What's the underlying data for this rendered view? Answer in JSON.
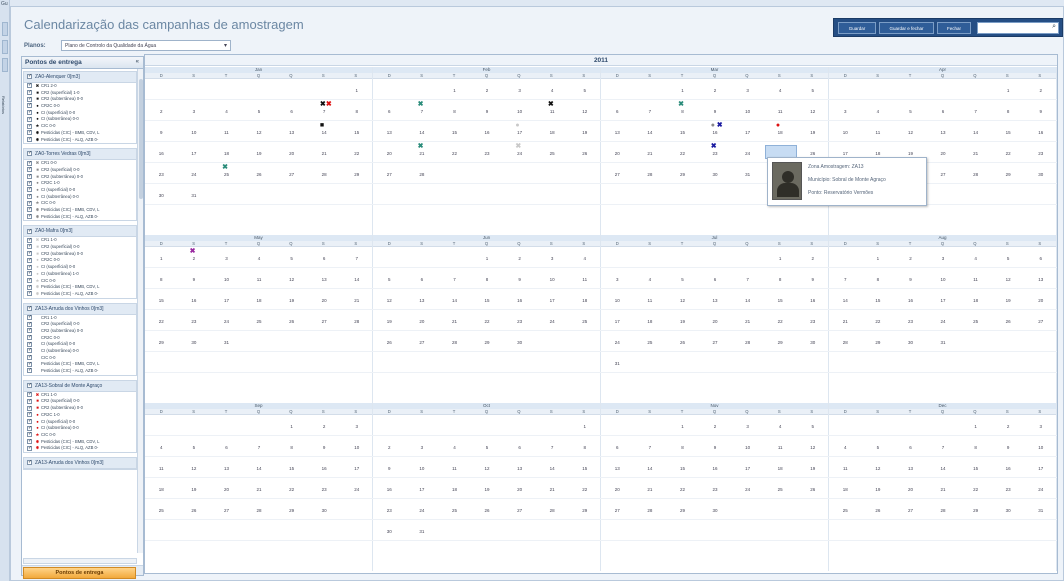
{
  "window": {
    "corner_label": "Gu"
  },
  "left_strip": {
    "vertical_label": "Relatórios"
  },
  "header": {
    "title": "Calendarização das campanhas de amostragem"
  },
  "planos": {
    "label": "Planos:",
    "selected": "Plano de Controlo da Qualidade da Água"
  },
  "toolbar": {
    "save_label": "Guardar",
    "save_close_label": "Guardar e fechar",
    "close_label": "Fechar",
    "search_placeholder": ""
  },
  "left_panel": {
    "title": "Pontos de entrega",
    "footer_button": "Pontos de entrega",
    "groups": [
      {
        "name": "ZA0-Alenquer 0[m3]",
        "items": [
          {
            "label": "CR1 2-0",
            "sym": "✖",
            "color": "#111"
          },
          {
            "label": "CR2 (superficial) 1-0",
            "sym": "■",
            "color": "#111"
          },
          {
            "label": "CR2 (subterrânea) 0-0",
            "sym": "■",
            "color": "#111"
          },
          {
            "label": "CR2C 0-0",
            "sym": "●",
            "color": "#111"
          },
          {
            "label": "CI (superficial) 0-0",
            "sym": "●",
            "color": "#111"
          },
          {
            "label": "CI (subterrânea) 0-0",
            "sym": "●",
            "color": "#111"
          },
          {
            "label": "CIC 0-0",
            "sym": "★",
            "color": "#111"
          },
          {
            "label": "Pesticidas (CIC) - BMB, CDV, L",
            "sym": "✱",
            "color": "#111"
          },
          {
            "label": "Pesticidas (CIC) - ALQ, AZB 0-",
            "sym": "✱",
            "color": "#111"
          }
        ]
      },
      {
        "name": "ZA0-Torres Vedras 0[m3]",
        "items": [
          {
            "label": "CR1 0-0",
            "sym": "✖",
            "color": "#8a8a8a"
          },
          {
            "label": "CR2 (superficial) 0-0",
            "sym": "■",
            "color": "#8a8a8a"
          },
          {
            "label": "CR2 (subterrânea) 0-0",
            "sym": "■",
            "color": "#8a8a8a"
          },
          {
            "label": "CR2C 1-0",
            "sym": "●",
            "color": "#8a8a8a"
          },
          {
            "label": "CI (superficial) 0-0",
            "sym": "●",
            "color": "#8a8a8a"
          },
          {
            "label": "CI (subterrânea) 0-0",
            "sym": "●",
            "color": "#8a8a8a"
          },
          {
            "label": "CIC 0-0",
            "sym": "★",
            "color": "#8a8a8a"
          },
          {
            "label": "Pesticidas (CIC) - BMB, CDV, L",
            "sym": "✱",
            "color": "#8a8a8a"
          },
          {
            "label": "Pesticidas (CIC) - ALQ, AZB 0-",
            "sym": "✱",
            "color": "#8a8a8a"
          }
        ]
      },
      {
        "name": "ZA0-Mafra 0[m3]",
        "items": [
          {
            "label": "CR1 1-0",
            "sym": "✖",
            "color": "#c9c9c9"
          },
          {
            "label": "CR2 (superficial) 0-0",
            "sym": "■",
            "color": "#c9c9c9"
          },
          {
            "label": "CR2 (subterrânea) 0-0",
            "sym": "■",
            "color": "#c9c9c9"
          },
          {
            "label": "CR2C 0-0",
            "sym": "●",
            "color": "#c9c9c9"
          },
          {
            "label": "CI (superficial) 0-0",
            "sym": "●",
            "color": "#c9c9c9"
          },
          {
            "label": "CI (subterrânea) 1-0",
            "sym": "●",
            "color": "#c9c9c9"
          },
          {
            "label": "CIC 0-0",
            "sym": "★",
            "color": "#c9c9c9"
          },
          {
            "label": "Pesticidas (CIC) - BMB, CDV, L",
            "sym": "✱",
            "color": "#c9c9c9"
          },
          {
            "label": "Pesticidas (CIC) - ALQ, AZB 0-",
            "sym": "✱",
            "color": "#c9c9c9"
          }
        ]
      },
      {
        "name": "ZA13-Arruda dos Vinhos 0[m3]",
        "items": [
          {
            "label": "CR1 1-0",
            "sym": "",
            "color": "#ffffff"
          },
          {
            "label": "CR2 (superficial) 0-0",
            "sym": "",
            "color": "#ffffff"
          },
          {
            "label": "CR2 (subterrânea) 0-0",
            "sym": "",
            "color": "#ffffff"
          },
          {
            "label": "CR2C 0-0",
            "sym": "",
            "color": "#ffffff"
          },
          {
            "label": "CI (superficial) 0-0",
            "sym": "",
            "color": "#ffffff"
          },
          {
            "label": "CI (subterrânea) 0-0",
            "sym": "",
            "color": "#ffffff"
          },
          {
            "label": "CIC 0-0",
            "sym": "",
            "color": "#ffffff"
          },
          {
            "label": "Pesticidas (CIC) - BMB, CDV, L",
            "sym": "",
            "color": "#ffffff"
          },
          {
            "label": "Pesticidas (CIC) - ALQ, AZB 0-",
            "sym": "",
            "color": "#ffffff"
          }
        ]
      },
      {
        "name": "ZA13-Sobral de Monte Agraço",
        "items": [
          {
            "label": "CR1 1-0",
            "sym": "✖",
            "color": "#d11"
          },
          {
            "label": "CR2 (superficial) 0-0",
            "sym": "■",
            "color": "#d11"
          },
          {
            "label": "CR2 (subterrânea) 0-0",
            "sym": "■",
            "color": "#d11"
          },
          {
            "label": "CR2C 1-0",
            "sym": "●",
            "color": "#d11"
          },
          {
            "label": "CI (superficial) 0-0",
            "sym": "●",
            "color": "#d11"
          },
          {
            "label": "CI (subterrânea) 0-0",
            "sym": "●",
            "color": "#d11"
          },
          {
            "label": "CIC 0-0",
            "sym": "★",
            "color": "#d11"
          },
          {
            "label": "Pesticidas (CIC) - BMB, CDV, L",
            "sym": "✱",
            "color": "#d11"
          },
          {
            "label": "Pesticidas (CIC) - ALQ, AZB 0-",
            "sym": "✱",
            "color": "#d11"
          }
        ]
      },
      {
        "name": "ZA13-Arruda dos Vinhos 0[m3]",
        "items": []
      }
    ]
  },
  "calendar": {
    "year": "2011",
    "weekday_labels": [
      "D",
      "S",
      "T",
      "Q",
      "Q",
      "S",
      "S"
    ],
    "months": [
      {
        "name": "Jan",
        "start": 6,
        "days": 31
      },
      {
        "name": "Feb",
        "start": 2,
        "days": 28
      },
      {
        "name": "Mar",
        "start": 2,
        "days": 31
      },
      {
        "name": "Apr",
        "start": 5,
        "days": 30
      },
      {
        "name": "May",
        "start": 0,
        "days": 31
      },
      {
        "name": "Jun",
        "start": 3,
        "days": 30
      },
      {
        "name": "Jul",
        "start": 5,
        "days": 31
      },
      {
        "name": "Aug",
        "start": 1,
        "days": 31
      },
      {
        "name": "Sep",
        "start": 4,
        "days": 30
      },
      {
        "name": "Oct",
        "start": 6,
        "days": 31
      },
      {
        "name": "Nov",
        "start": 2,
        "days": 30
      },
      {
        "name": "Dec",
        "start": 4,
        "days": 31
      }
    ],
    "markers": [
      {
        "month": 0,
        "day": 7,
        "sym": "✖",
        "color": "#111"
      },
      {
        "month": 0,
        "day": 7,
        "sym": "✖",
        "color": "#d11",
        "off": 1
      },
      {
        "month": 0,
        "day": 14,
        "sym": "■",
        "color": "#111"
      },
      {
        "month": 0,
        "day": 25,
        "sym": "✖",
        "color": "#2a8c7a"
      },
      {
        "month": 1,
        "day": 7,
        "sym": "✖",
        "color": "#2a8c7a"
      },
      {
        "month": 1,
        "day": 11,
        "sym": "✖",
        "color": "#111"
      },
      {
        "month": 1,
        "day": 17,
        "sym": "●",
        "color": "#c9c9c9"
      },
      {
        "month": 1,
        "day": 21,
        "sym": "✖",
        "color": "#2a8c7a"
      },
      {
        "month": 1,
        "day": 24,
        "sym": "✖",
        "color": "#c9c9c9"
      },
      {
        "month": 2,
        "day": 8,
        "sym": "✖",
        "color": "#2a8c7a"
      },
      {
        "month": 2,
        "day": 16,
        "sym": "●",
        "color": "#8a8a8a"
      },
      {
        "month": 2,
        "day": 16,
        "sym": "✖",
        "color": "#1a1aa0",
        "off": 1
      },
      {
        "month": 2,
        "day": 18,
        "sym": "●",
        "color": "#d11"
      },
      {
        "month": 2,
        "day": 23,
        "sym": "✖",
        "color": "#1a1aa0"
      },
      {
        "month": 4,
        "day": 2,
        "sym": "✖",
        "color": "#9a2aa0"
      }
    ],
    "tooltip": {
      "line1": "Zona Amostragem: ZA13",
      "line2": "Município: Sobral de Monte Agraço",
      "line3": "Ponto: Reservatório Vermões"
    }
  }
}
